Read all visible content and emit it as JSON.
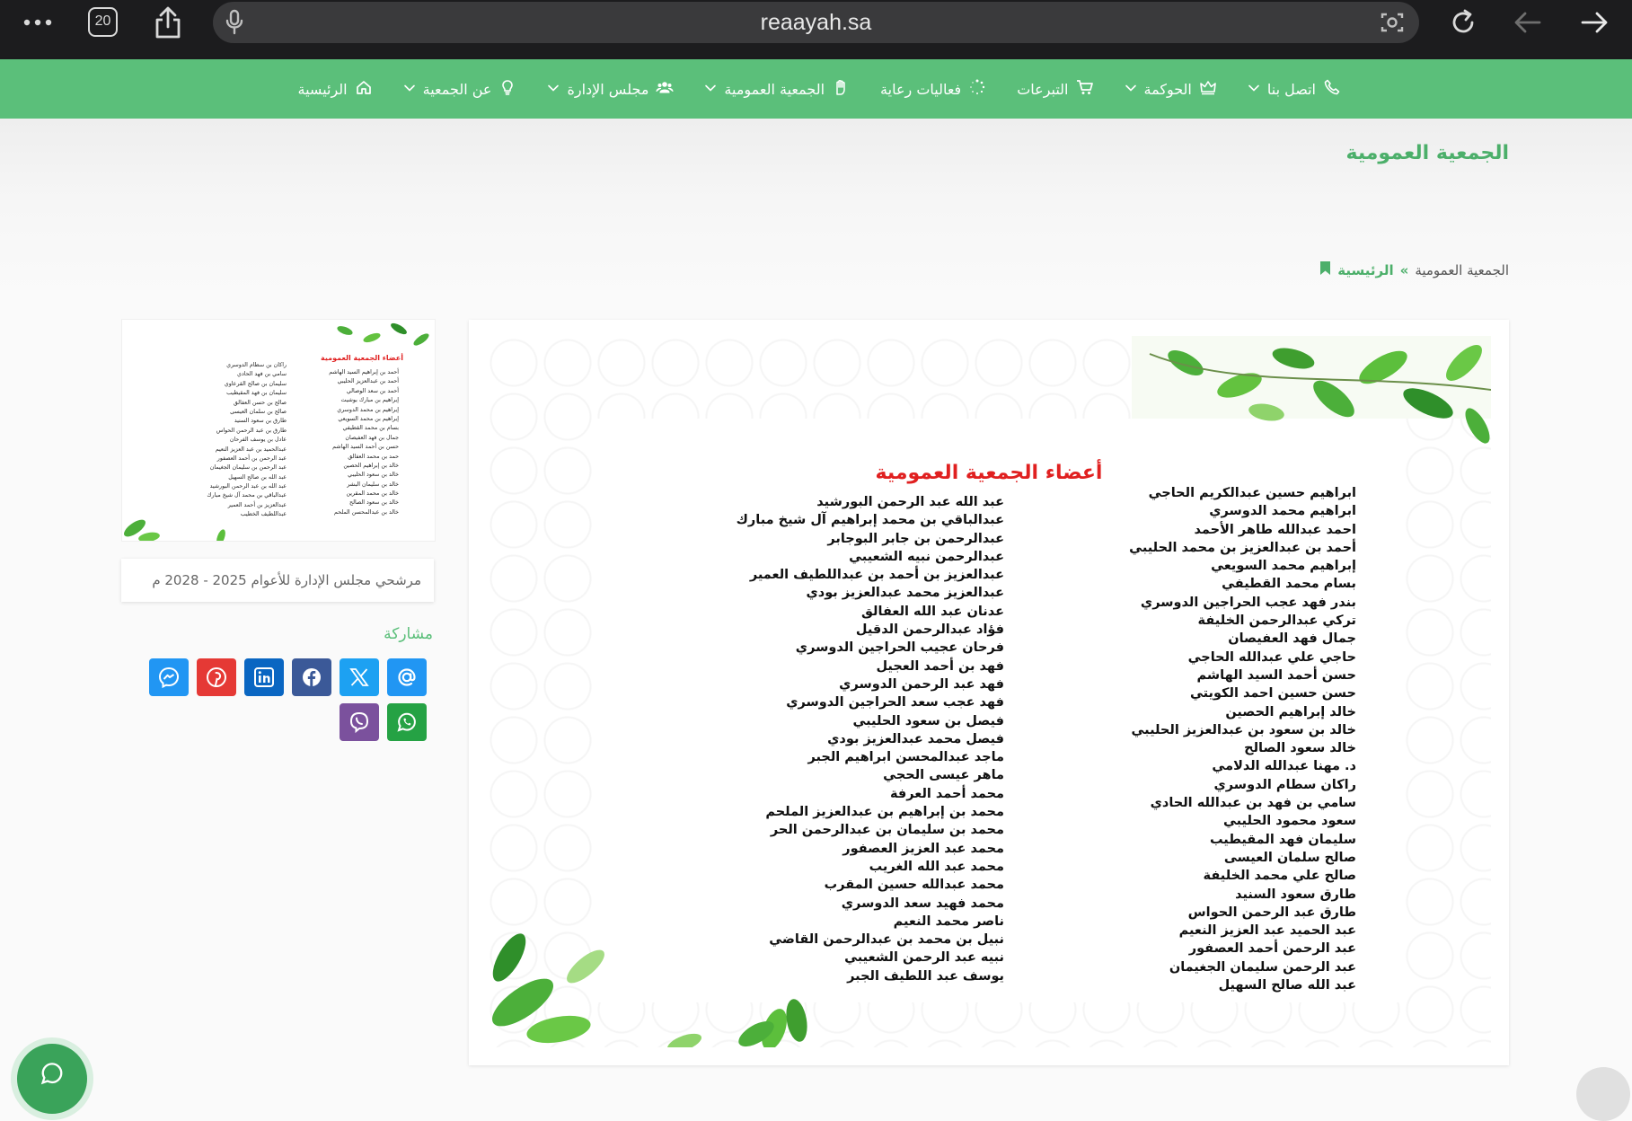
{
  "browser": {
    "tab_count": "20",
    "url": "reaayah.sa"
  },
  "nav": {
    "items": [
      {
        "label": "الرئيسية",
        "icon": "home-icon",
        "dropdown": false
      },
      {
        "label": "عن الجمعية",
        "icon": "lightbulb-icon",
        "dropdown": true
      },
      {
        "label": "مجلس الإدارة",
        "icon": "users-icon",
        "dropdown": true
      },
      {
        "label": "الجمعية العمومية",
        "icon": "hand-icon",
        "dropdown": true
      },
      {
        "label": "فعاليات رعاية",
        "icon": "spinner-icon",
        "dropdown": false
      },
      {
        "label": "التبرعات",
        "icon": "cart-icon",
        "dropdown": false
      },
      {
        "label": "الحوكمة",
        "icon": "crown-icon",
        "dropdown": true
      },
      {
        "label": "اتصل بنا",
        "icon": "phone-icon",
        "dropdown": true
      }
    ]
  },
  "page": {
    "title": "الجمعية العمومية",
    "breadcrumb": {
      "home": "الرئيسية",
      "separator": "»",
      "current": "الجمعية العمومية"
    }
  },
  "poster": {
    "title": "أعضاء الجمعية العمومية",
    "right_column": [
      "ابراهيم حسين عبدالكريم الحاجي",
      "ابراهيم محمد الدوسري",
      "احمد عبدالله طاهر الأحمد",
      "أحمد بن عبدالعزيز بن محمد الحليبي",
      "إبراهيم محمد السويعي",
      "بسام محمد القطيفي",
      "بندر فهد عجب الحراجين الدوسري",
      "تركي عبدالرحمن الخليفة",
      "جمال فهد العفيصان",
      "حاجي علي عبدالله الحاجي",
      "حسن أحمد السيد الهاشم",
      "حسن حسين احمد الكويتي",
      "خالد إبراهيم الحصين",
      "خالد بن سعود بن عبدالعزيز الحليبي",
      "خالد سعود الصالح",
      "د. مهنا عبدالله الدلامي",
      "راكان سطام الدوسري",
      "سامي بن فهد بن عبدالله الحادي",
      "سعود محمود الحليبي",
      "سليمان فهد المقيطيب",
      "صالح سلمان العيسى",
      "صالح علي محمد الخليفة",
      "طارق سعود السنيد",
      "طارق عبد الرحمن الحواس",
      "عبد الحميد عبد العزيز النعيم",
      "عبد الرحمن أحمد العصفور",
      "عبد الرحمن سليمان الجغيمان",
      "عبد الله صالح السهيل"
    ],
    "left_column": [
      "عبد الله عبد الرحمن البورشيد",
      "عبدالباقي بن محمد إبراهيم آل شيخ مبارك",
      "عبدالرحمن بن جابر البوجابر",
      "عبدالرحمن نبيه الشعيبي",
      "عبدالعزيز بن أحمد بن عبداللطيف العمير",
      "عبدالعزيز محمد عبدالعزيز بودي",
      "عدنان عبد الله العفالق",
      "فؤاد عبدالرحمن الدقيل",
      "فرحان عجيب الحراجين الدوسري",
      "فهد بن أحمد العجيل",
      "فهد عبد الرحمن الدوسري",
      "فهد عجب سعد الحراجين الدوسري",
      "فيصل بن سعود الحليبي",
      "فيصل محمد عبدالعزيز بودي",
      "ماجد عبدالمحسن ابراهيم الجبر",
      "ماهر عيسى الحجي",
      "محمد أحمد العرفة",
      "محمد بن إبراهيم بن عبدالعزيز الملحم",
      "محمد بن سليمان بن عبدالرحمن الحر",
      "محمد عبد العزيز العصفور",
      "محمد عبد الله الغريب",
      "محمد عبدالله حسين المقرب",
      "محمد فهيد سعد الدوسري",
      "ناصر محمد النعيم",
      "نبيل بن محمد بن عبدالرحمن القاضي",
      "نبيه عبد الرحمن الشعيبي",
      "يوسف عبد اللطيف الجبر"
    ]
  },
  "sidebar": {
    "thumbnail": {
      "title": "أعضاء الجمعية العمومية",
      "right_column": [
        "أحمد بن إبراهيم السيد الهاشم",
        "أحمد بن عبدالعزيز الحليبي",
        "أحمد بن سعد الوصالي",
        "إبراهيم بن مبارك بوشيت",
        "إبراهيم بن محمد الدوسري",
        "إبراهيم بن محمد السويعي",
        "بسام بن محمد القطيفي",
        "جمال بن فهد العفيصان",
        "حسن بن أحمد السيد الهاشم",
        "حمد بن محمد العفالق",
        "خالد بن إبراهيم الحصين",
        "خالد بن سعود الحليبي",
        "خالد بن سليمان البشر",
        "خالد بن محمد المقرين",
        "خالد بن سعود الصالح",
        "خالد بن عبدالمحسن الملحم"
      ],
      "left_column": [
        "راكان بن سطام الدوسري",
        "سامي بن فهد الحادي",
        "سليمان بن صالح القرعاوي",
        "سليمان بن فهد المقيطيب",
        "صالح بن حسن العفالق",
        "صالح بن سلمان العيسى",
        "طارق بن سعود السنيد",
        "طارق بن عبد الرحمن الحواس",
        "عادل بن يوسف الفرحان",
        "عبدالحميد بن عبد العزيز النعيم",
        "عبد الرحمن بن أحمد العصفور",
        "عبد الرحمن بن سليمان الجغيمان",
        "عبد الله بن صالح السهيل",
        "عبد الله بن عبد الرحمن البورشيد",
        "عبدالباقي بن محمد آل شيخ مبارك",
        "عبدالعزيز بن أحمد العمير",
        "عبداللطيف الخطيب"
      ]
    },
    "candidate_label": "مرشحي مجلس الإدارة للأعوام 2025 - 2028 م",
    "share_label": "مشاركة",
    "share_buttons": [
      {
        "name": "messenger",
        "icon": "messenger-icon",
        "color": "#2196f3"
      },
      {
        "name": "pinterest",
        "icon": "pinterest-icon",
        "color": "#e53935"
      },
      {
        "name": "linkedin",
        "icon": "linkedin-icon",
        "color": "#0a66c2"
      },
      {
        "name": "facebook",
        "icon": "facebook-icon",
        "color": "#3b5998"
      },
      {
        "name": "x",
        "icon": "x-icon",
        "color": "#1da1f2"
      },
      {
        "name": "threads",
        "icon": "at-icon",
        "color": "#2196f3"
      },
      {
        "name": "viber",
        "icon": "viber-icon",
        "color": "#7b519d"
      },
      {
        "name": "whatsapp",
        "icon": "whatsapp-icon",
        "color": "#25a244"
      }
    ]
  },
  "colors": {
    "brand_green": "#5bbf7a",
    "title_green": "#4caf6a",
    "poster_red": "#e02020",
    "browser_dark": "#1c1c1e"
  }
}
